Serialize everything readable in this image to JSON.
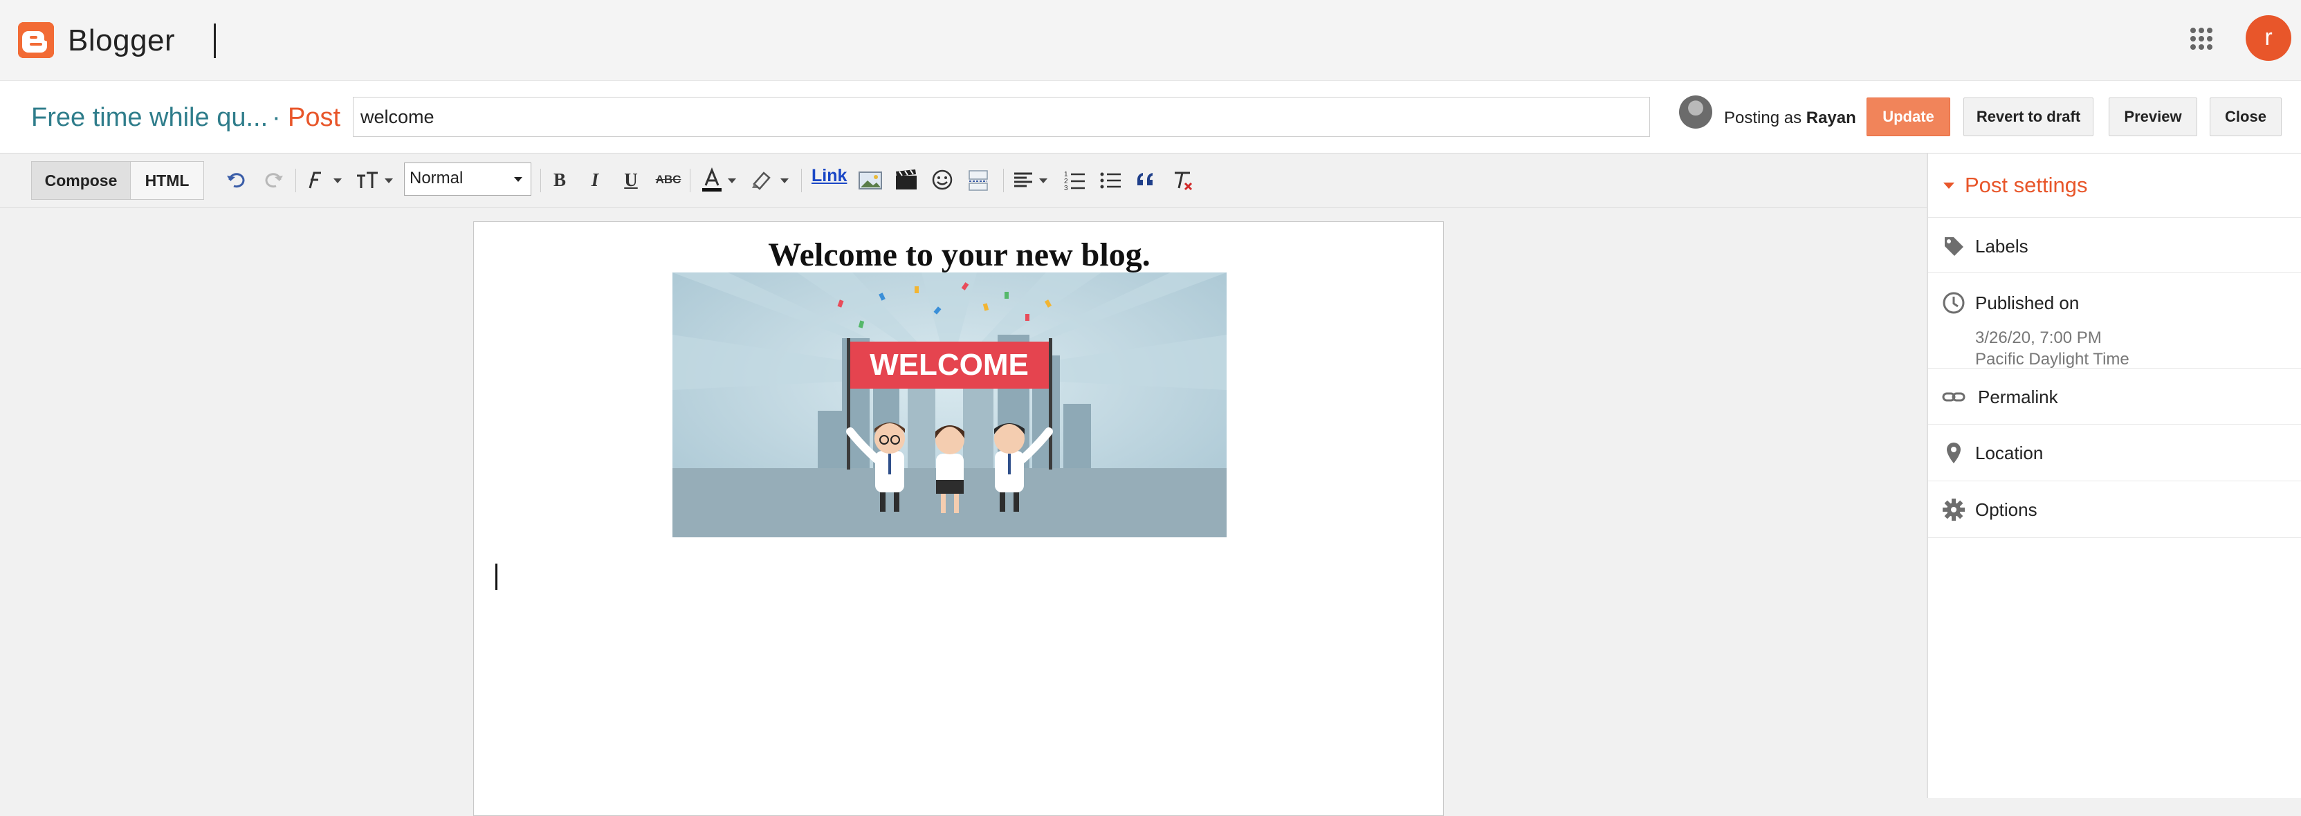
{
  "app": {
    "brand": "Blogger",
    "avatar_letter": "r",
    "brand_color": "#f26b35"
  },
  "post_header": {
    "blog_name": "Free time while qu...",
    "separator": "·",
    "section": "Post",
    "title_value": "welcome",
    "posting_as_prefix": "Posting as",
    "author": "Rayan",
    "buttons": {
      "update": "Update",
      "revert": "Revert to draft",
      "preview": "Preview",
      "close": "Close"
    }
  },
  "toolbar": {
    "compose": "Compose",
    "html": "HTML",
    "format_value": "Normal",
    "link": "Link",
    "icons": [
      "undo-icon",
      "redo-icon",
      "font-icon",
      "font-size-icon",
      "bold-icon",
      "italic-icon",
      "underline-icon",
      "strikethrough-icon",
      "text-color-icon",
      "highlight-icon",
      "image-icon",
      "video-icon",
      "emoji-icon",
      "jump-break-icon",
      "align-icon",
      "numbered-list-icon",
      "bullet-list-icon",
      "quote-icon",
      "clear-formatting-icon"
    ]
  },
  "editor": {
    "heading": "Welcome to your new blog.",
    "image_banner_text": "WELCOME"
  },
  "sidebar": {
    "title": "Post settings",
    "items": [
      {
        "label": "Labels",
        "icon": "label-tag-icon"
      },
      {
        "label": "Published on",
        "icon": "clock-icon",
        "detail": [
          "3/26/20, 7:00 PM",
          "Pacific Daylight Time"
        ]
      },
      {
        "label": "Permalink",
        "icon": "link-icon"
      },
      {
        "label": "Location",
        "icon": "location-pin-icon"
      },
      {
        "label": "Options",
        "icon": "gear-icon"
      }
    ],
    "accent": "#e8562a"
  }
}
